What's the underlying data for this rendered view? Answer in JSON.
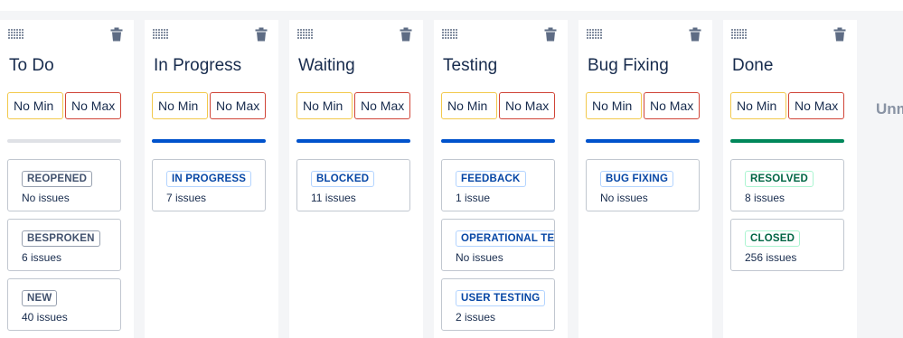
{
  "limits": {
    "min_label": "No Min",
    "max_label": "No Max"
  },
  "colors": {
    "todo": "#dfe1e6",
    "in_progress": "#0052cc",
    "done": "#00875a",
    "min_border": "#f2c94c",
    "max_border": "#d04437"
  },
  "columns": [
    {
      "title": "To Do",
      "statuses": [
        {
          "label": "REOPENED",
          "count": "No issues",
          "style": "grey"
        },
        {
          "label": "BESPROKEN",
          "count": "6 issues",
          "style": "grey"
        },
        {
          "label": "NEW",
          "count": "40 issues",
          "style": "grey"
        }
      ]
    },
    {
      "title": "In Progress",
      "statuses": [
        {
          "label": "IN PROGRESS",
          "count": "7 issues",
          "style": "blue"
        }
      ]
    },
    {
      "title": "Waiting",
      "statuses": [
        {
          "label": "BLOCKED",
          "count": "11 issues",
          "style": "blue"
        }
      ]
    },
    {
      "title": "Testing",
      "statuses": [
        {
          "label": "FEEDBACK",
          "count": "1 issue",
          "style": "blue"
        },
        {
          "label": "OPERATIONAL TEST",
          "count": "No issues",
          "style": "blue"
        },
        {
          "label": "USER TESTING",
          "count": "2 issues",
          "style": "blue"
        }
      ]
    },
    {
      "title": "Bug Fixing",
      "statuses": [
        {
          "label": "BUG FIXING",
          "count": "No issues",
          "style": "blue"
        }
      ]
    },
    {
      "title": "Done",
      "statuses": [
        {
          "label": "RESOLVED",
          "count": "8 issues",
          "style": "green"
        },
        {
          "label": "CLOSED",
          "count": "256 issues",
          "style": "green"
        }
      ]
    }
  ],
  "unmapped_label": "Unm",
  "icons": {
    "drag": "drag-handle-icon",
    "delete": "trash-icon"
  }
}
